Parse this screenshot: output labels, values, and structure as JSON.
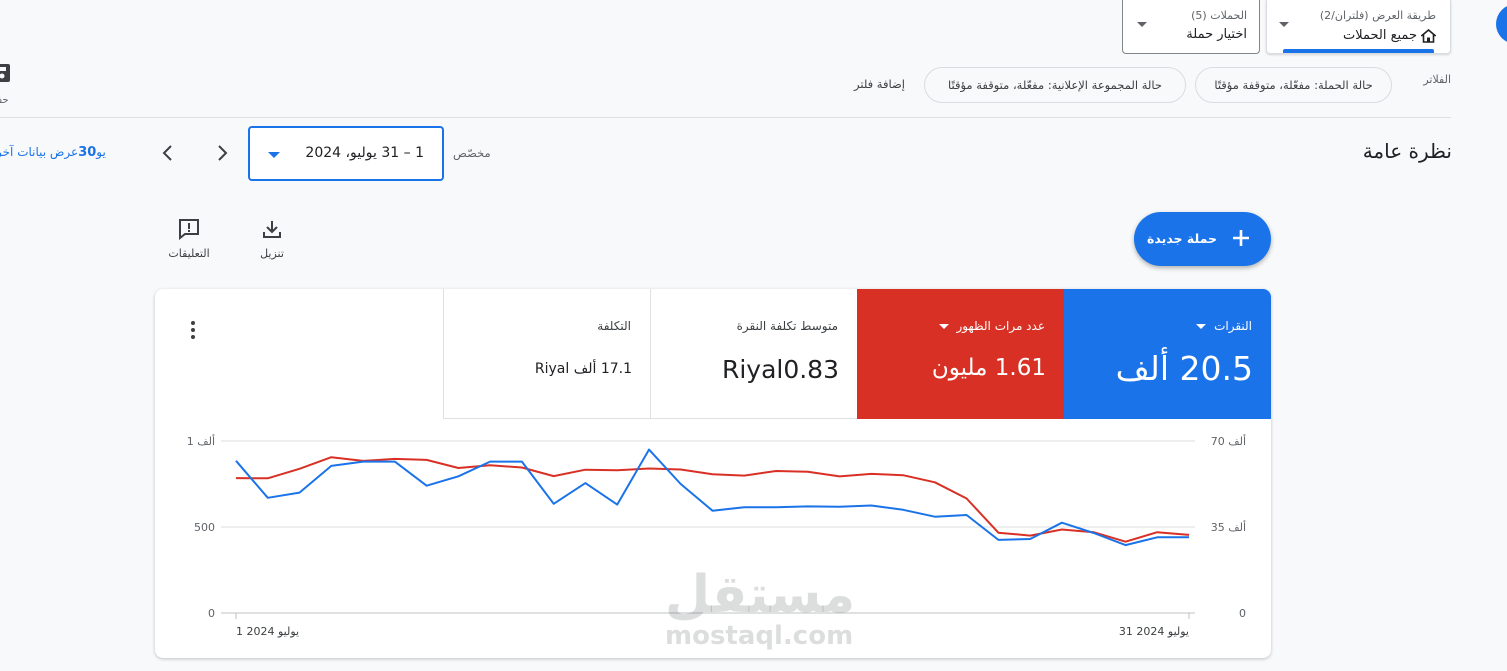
{
  "top_selectors": {
    "view_mode": {
      "small": "طريقة العرض (فلتران/2)",
      "value": "جميع الحملات"
    },
    "campaigns": {
      "small": "الحملات (5)",
      "value": "اختيار حملة"
    }
  },
  "left_edge": {
    "label": "حف"
  },
  "filters": {
    "label": "الفلاتر",
    "chips": [
      "حالة الحملة: مفعّلة، متوقفة مؤقتًا",
      "حالة المجموعة الإعلانية: مفعّلة، متوقفة مؤقتًا"
    ],
    "add_filter": "إضافة فلتر"
  },
  "overview": {
    "title": "نظرة عامة",
    "date_range": "1 – 31 يوليو، 2024",
    "custom_label": "مخصّص",
    "show_last_prefix": "عرض بيانات آخر ",
    "show_last_number": "30",
    "show_last_suffix": " يو"
  },
  "fab": {
    "label": "حملة جديدة"
  },
  "tools": {
    "download": "تنزيل",
    "feedback": "التعليقات"
  },
  "metrics": {
    "clicks": {
      "label": "النقرات",
      "value": "20.5 ألف",
      "color": "#1a73e8"
    },
    "impressions": {
      "label": "عدد مرات الظهور",
      "value": "1.61 مليون",
      "color": "#d93025"
    },
    "avg_cpc": {
      "label": "متوسط تكلفة النقرة",
      "value": "Riyal0.83"
    },
    "cost": {
      "label": "التكلفة",
      "value": "17.1 ألف Riyal"
    }
  },
  "chart_data": {
    "type": "line",
    "x_start_label": "1 يوليو 2024",
    "x_end_label": "31 يوليو 2024",
    "x": [
      1,
      2,
      3,
      4,
      5,
      6,
      7,
      8,
      9,
      10,
      11,
      12,
      13,
      14,
      15,
      16,
      17,
      18,
      19,
      20,
      21,
      22,
      23,
      24,
      25,
      26,
      27,
      28,
      29,
      30,
      31
    ],
    "left_axis": {
      "ticks": [
        "0",
        "500",
        "1 ألف"
      ],
      "ylim": [
        0,
        1000
      ]
    },
    "right_axis": {
      "ticks": [
        "0",
        "35 ألف",
        "70 ألف"
      ],
      "ylim": [
        0,
        70000
      ]
    },
    "series": [
      {
        "name": "النقرات",
        "axis": "left",
        "color": "#1a73e8",
        "values": [
          885,
          670,
          700,
          855,
          880,
          880,
          740,
          795,
          880,
          880,
          635,
          755,
          630,
          950,
          750,
          595,
          615,
          615,
          620,
          618,
          625,
          600,
          560,
          570,
          425,
          430,
          525,
          465,
          395,
          440,
          440
        ]
      },
      {
        "name": "عدد مرات الظهور",
        "axis": "right",
        "color": "#d93025",
        "values": [
          54900,
          54800,
          58700,
          63400,
          61900,
          62700,
          62300,
          59000,
          60100,
          59200,
          55700,
          58300,
          58100,
          58800,
          58400,
          56500,
          55900,
          57800,
          57500,
          55600,
          56600,
          56100,
          53200,
          46600,
          32700,
          31500,
          34000,
          32900,
          29000,
          32900,
          31800
        ]
      }
    ]
  }
}
